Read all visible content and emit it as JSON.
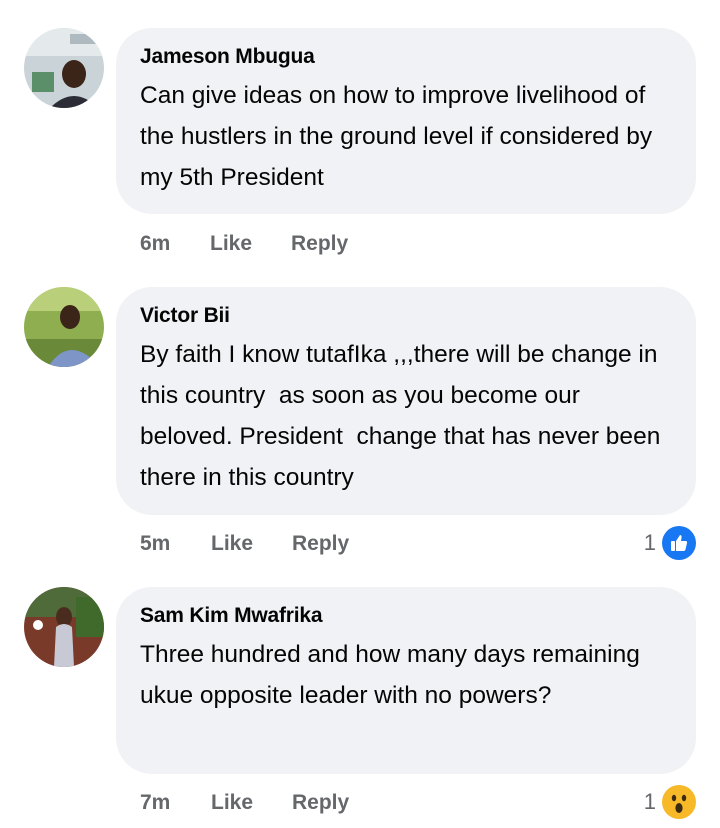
{
  "comments": [
    {
      "author": "Jameson Mbugua",
      "text": "Can give ideas on how to improve livelihood of the hustlers in the ground level if considered by my 5th President",
      "time": "6m",
      "like_label": "Like",
      "reply_label": "Reply"
    },
    {
      "author": "Victor Bii",
      "text": "By faith I know tutafIka ,,,there will be change in this country  as soon as you become our beloved. President  change that has never been there in this country",
      "time": "5m",
      "like_label": "Like",
      "reply_label": "Reply",
      "reaction": {
        "count": "1",
        "icon": "like-icon",
        "color": "#1877f2"
      }
    },
    {
      "author": "Sam Kim Mwafrika",
      "text": "Three hundred and how many days remaining ukue opposite leader with no powers?",
      "time": "7m",
      "like_label": "Like",
      "reply_label": "Reply",
      "reaction": {
        "count": "1",
        "icon": "wow-icon",
        "color": "#f7b928"
      }
    }
  ]
}
